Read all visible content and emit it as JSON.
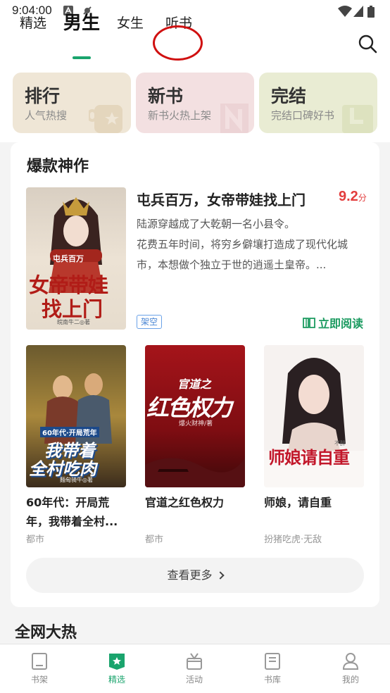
{
  "status_bar": {
    "time": "9:04:00"
  },
  "tabs": [
    {
      "label": "精选"
    },
    {
      "label": "男生"
    },
    {
      "label": "女生"
    },
    {
      "label": "听书"
    }
  ],
  "categories": [
    {
      "title": "排行",
      "subtitle": "人气热搜",
      "color": "#efe6d6"
    },
    {
      "title": "新书",
      "subtitle": "新书火热上架",
      "color": "#f3e0e1"
    },
    {
      "title": "完结",
      "subtitle": "完结口碑好书",
      "color": "#e9ecd3"
    }
  ],
  "section": {
    "title": "爆款神作",
    "featured": {
      "title": "屯兵百万，女帝带娃找上门",
      "score": "9.2",
      "score_unit": "分",
      "desc_lines": [
        "陆源穿越成了大乾朝一名小县令。",
        "花费五年时间，将穷乡僻壤打造成了现代化城",
        "市，本想做个独立于世的逍遥土皇帝。..."
      ],
      "tag": "架空",
      "read_label": "立即阅读",
      "cover_text_top": "屯兵百万",
      "cover_text_main": "女帝带娃",
      "cover_text_main2": "找上门",
      "cover_author": "皖南牛二◎著"
    },
    "books": [
      {
        "title_lines": [
          "60年代：开局荒",
          "年，我带着全村..."
        ],
        "meta": "都市",
        "cover_text1": "60年代·开局荒年",
        "cover_text2": "我带着",
        "cover_text3": "全村吃肉",
        "cover_author": "麵甸骑牛◎著"
      },
      {
        "title_lines": [
          "官道之红色权力"
        ],
        "meta": "都市",
        "cover_text1": "官道之",
        "cover_text2": "红色权力",
        "cover_author": "爆火财神/著"
      },
      {
        "title_lines": [
          "师娘，请自重"
        ],
        "meta": "扮猪吃虎·无敌",
        "cover_text1": "师娘请自重",
        "cover_author": "不醉"
      }
    ],
    "more_label": "查看更多"
  },
  "section2": {
    "title": "全网大热"
  },
  "bottom_nav": [
    {
      "label": "书架"
    },
    {
      "label": "精选"
    },
    {
      "label": "活动"
    },
    {
      "label": "书库"
    },
    {
      "label": "我的"
    }
  ],
  "accent_color": "#1aa46d",
  "score_color": "#e33d3d"
}
